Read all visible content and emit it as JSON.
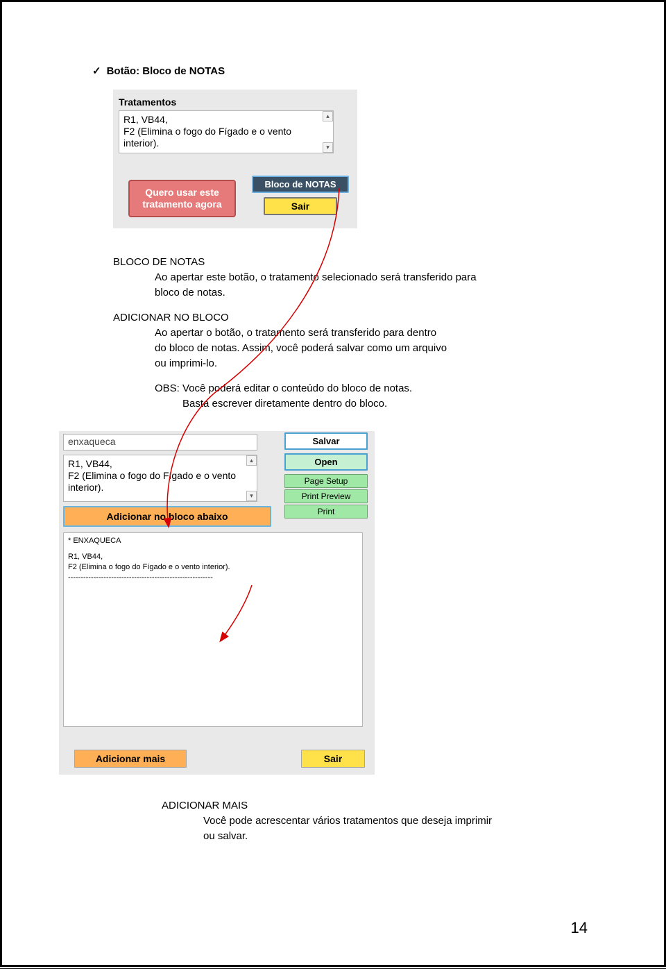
{
  "heading": "Botão: Bloco de NOTAS",
  "panel1": {
    "title": "Tratamentos",
    "line1": "R1, VB44,",
    "line2": "F2 (Elimina o fogo do Fígado e o vento interior).",
    "btn_red": "Quero usar este tratamento agora",
    "btn_dark": "Bloco de NOTAS",
    "btn_yellow": "Sair"
  },
  "para": {
    "h1": "BLOCO DE NOTAS",
    "p1a": "Ao apertar este botão, o tratamento selecionado será transferido para",
    "p1b": "bloco de notas.",
    "h2": "ADICIONAR NO BLOCO",
    "p2a": "Ao apertar o botão, o tratamento será transferido para dentro",
    "p2b": "do bloco de notas. Assim, você poderá salvar como um arquivo",
    "p2c": "ou imprimi-lo.",
    "obs1": "OBS: Você poderá editar o conteúdo do bloco de notas.",
    "obs2": "Basta escrever diretamente dentro do bloco."
  },
  "panel2": {
    "input": "enxaqueca",
    "box2_l1": "R1, VB44,",
    "box2_l2": "F2 (Elimina o fogo do Fígado e o vento interior).",
    "btn_add": "Adicionar no bloco abaixo",
    "btn_save": "Salvar",
    "btn_open": "Open",
    "btn_pagesetup": "Page Setup",
    "btn_preview": "Print Preview",
    "btn_print": "Print",
    "big_l1": "* ENXAQUECA",
    "big_l2": "R1, VB44,",
    "big_l3": "F2 (Elimina o fogo do Fígado e o vento interior).",
    "big_l4": "---------------------------------------------------------",
    "btn_addmore": "Adicionar mais",
    "btn_exit": "Sair"
  },
  "bottom": {
    "h": "ADICIONAR MAIS",
    "l1": "Você pode acrescentar vários tratamentos que deseja imprimir",
    "l2": "ou salvar."
  },
  "pagenum": "14"
}
